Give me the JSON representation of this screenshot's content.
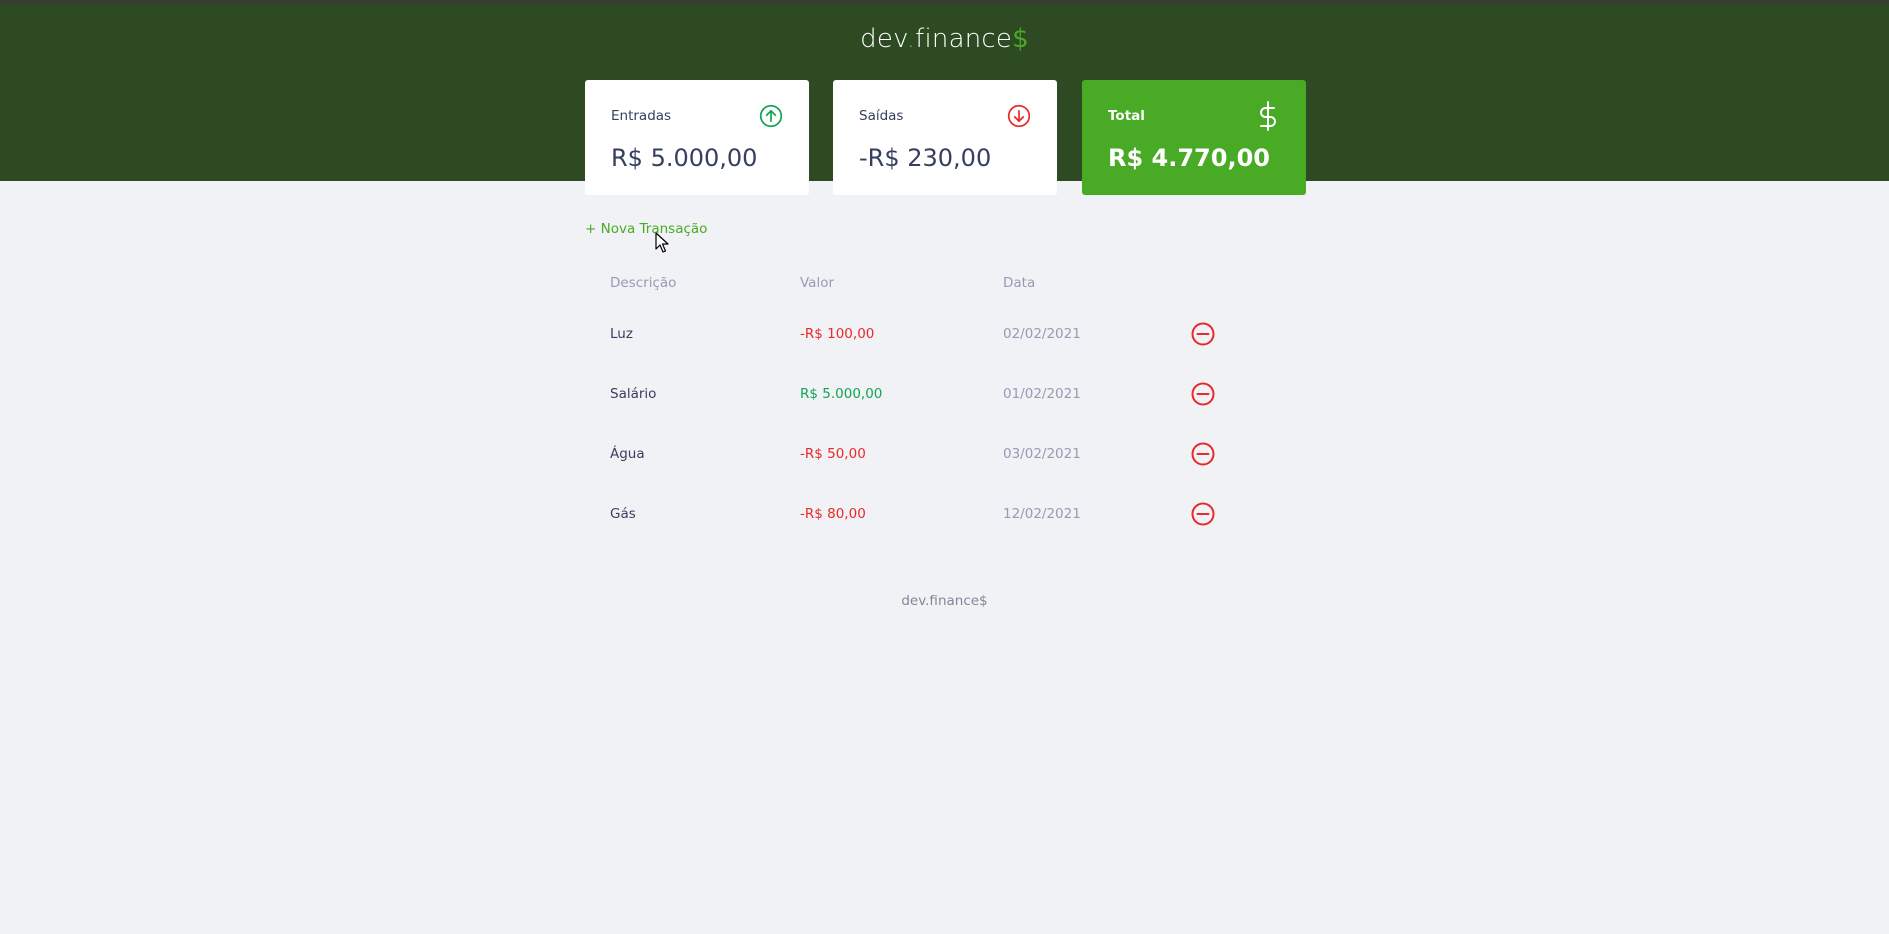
{
  "header": {
    "logo_main": "dev",
    "logo_dot": ".",
    "logo_rest": "finance",
    "logo_dollar": "$"
  },
  "cards": {
    "income": {
      "label": "Entradas",
      "amount": "R$ 5.000,00",
      "icon": "arrow-up-circle-icon",
      "color": "#12a454"
    },
    "expense": {
      "label": "Saídas",
      "amount": "-R$ 230,00",
      "icon": "arrow-down-circle-icon",
      "color": "#e92929"
    },
    "total": {
      "label": "Total",
      "amount": "R$ 4.770,00",
      "icon": "dollar-sign-icon",
      "color": "#49aa26"
    }
  },
  "new_transaction": "+ Nova Transação",
  "table": {
    "headers": [
      "Descrição",
      "Valor",
      "Data",
      ""
    ],
    "rows": [
      {
        "description": "Luz",
        "amount": "-R$ 100,00",
        "type": "expense",
        "date": "02/02/2021"
      },
      {
        "description": "Salário",
        "amount": "R$ 5.000,00",
        "type": "income",
        "date": "01/02/2021"
      },
      {
        "description": "Água",
        "amount": "-R$ 50,00",
        "type": "expense",
        "date": "03/02/2021"
      },
      {
        "description": "Gás",
        "amount": "-R$ 80,00",
        "type": "expense",
        "date": "12/02/2021"
      }
    ],
    "remove_icon": "minus-circle-icon"
  },
  "footer": "dev.finance$",
  "colors": {
    "header_bg": "#2d4a22",
    "accent": "#49aa26",
    "income": "#12a454",
    "expense": "#e92929",
    "text": "#363f5f",
    "muted": "#969cb3"
  }
}
